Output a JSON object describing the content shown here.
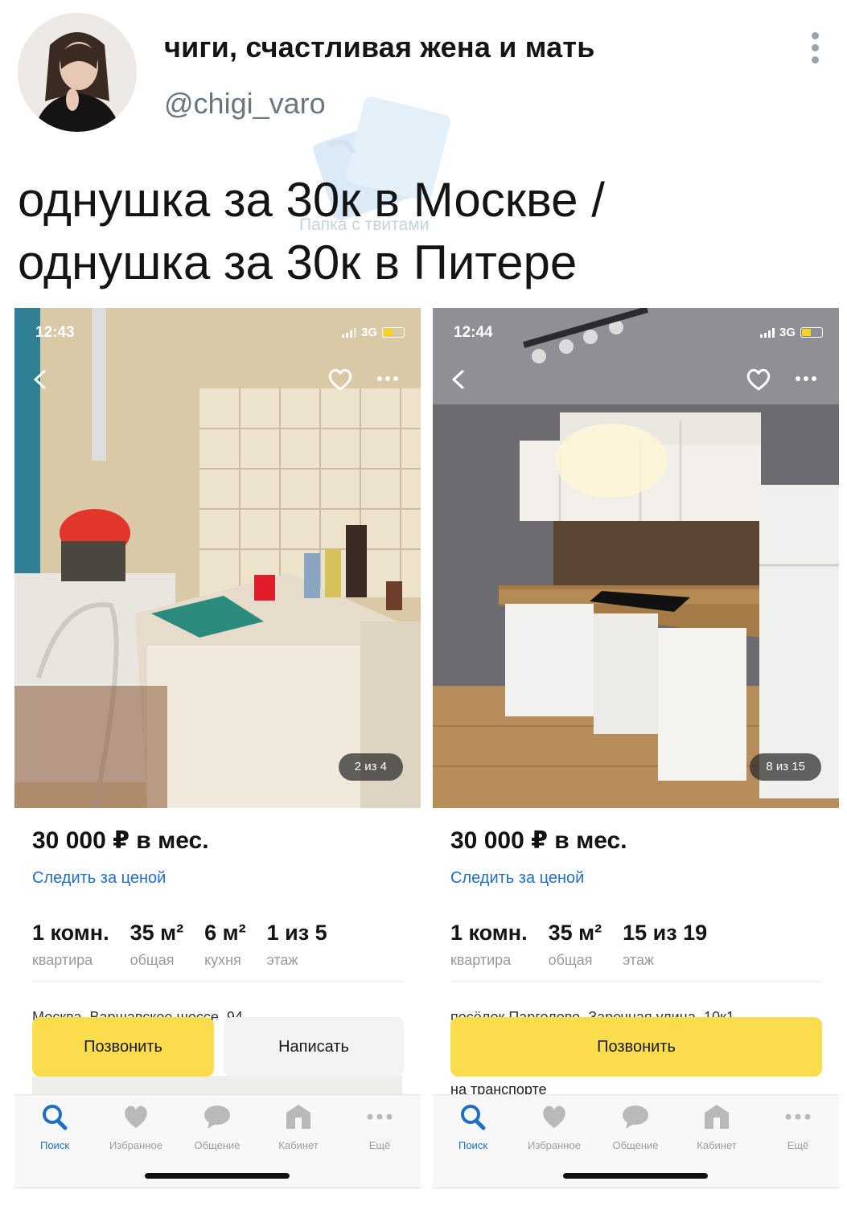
{
  "tweet": {
    "display_name": "чиги, счастливая жена и мать",
    "handle": "@chigi_varo",
    "watermark": "Папка с твитами",
    "text_line1": "однушка за 30к в Москве /",
    "text_line2": "однушка за 30к в Питере"
  },
  "cards": [
    {
      "status_time": "12:43",
      "network": "3G",
      "photo_counter": "2 из 4",
      "price": "30 000 ₽ в мес.",
      "follow_price": "Следить за ценой",
      "stats": [
        {
          "value": "1 комн.",
          "label": "квартира"
        },
        {
          "value": "35 м²",
          "label": "общая"
        },
        {
          "value": "6 м²",
          "label": "кухня"
        },
        {
          "value": "1 из 5",
          "label": "этаж"
        }
      ],
      "address_partial": "Москва, Варшавское шоссе, 94",
      "buttons": {
        "call": "Позвонить",
        "write": "Написать"
      },
      "tabs": [
        {
          "label": "Поиск",
          "icon": "search-icon",
          "active": true
        },
        {
          "label": "Избранное",
          "icon": "heart-icon",
          "active": false
        },
        {
          "label": "Общение",
          "icon": "chat-icon",
          "active": false
        },
        {
          "label": "Кабинет",
          "icon": "home-icon",
          "active": false
        },
        {
          "label": "Ещё",
          "icon": "dots-icon",
          "active": false
        }
      ]
    },
    {
      "status_time": "12:44",
      "network": "3G",
      "photo_counter": "8 из 15",
      "price": "30 000 ₽ в мес.",
      "follow_price": "Следить за ценой",
      "stats": [
        {
          "value": "1 комн.",
          "label": "квартира"
        },
        {
          "value": "35 м²",
          "label": "общая"
        },
        {
          "value": "15 из 19",
          "label": "этаж"
        }
      ],
      "address_partial": "посёлок Парголово, Заречная улица, 10к1",
      "address_extra": "на транспорте",
      "buttons": {
        "call": "Позвонить"
      },
      "tabs": [
        {
          "label": "Поиск",
          "icon": "search-icon",
          "active": true
        },
        {
          "label": "Избранное",
          "icon": "heart-icon",
          "active": false
        },
        {
          "label": "Общение",
          "icon": "chat-icon",
          "active": false
        },
        {
          "label": "Кабинет",
          "icon": "home-icon",
          "active": false
        },
        {
          "label": "Ещё",
          "icon": "dots-icon",
          "active": false
        }
      ]
    }
  ],
  "colors": {
    "accent_yellow": "#fbdc4c",
    "link_blue": "#1f6fc7",
    "handle_gray": "#6b7680"
  }
}
